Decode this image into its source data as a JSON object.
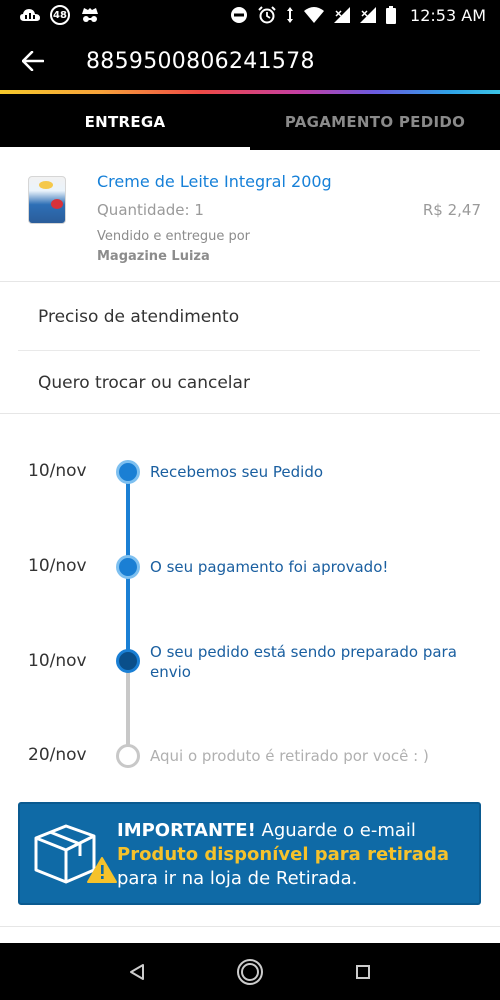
{
  "status_bar": {
    "notification_badge": "48",
    "time": "12:53 AM",
    "icons": [
      "cloud-icon",
      "notification-count-icon",
      "incognito-icon",
      "do-not-disturb-icon",
      "alarm-icon",
      "data-transfer-icon",
      "wifi-icon",
      "signal-icon",
      "signal-icon",
      "battery-icon"
    ]
  },
  "app_bar": {
    "back_icon": "arrow-left-icon",
    "title": "8859500806241578"
  },
  "tabs": [
    {
      "label": "ENTREGA",
      "active": true
    },
    {
      "label": "PAGAMENTO PEDIDO",
      "active": false
    }
  ],
  "product": {
    "name": "Creme de Leite Integral 200g",
    "quantity": "Quantidade: 1",
    "price": "R$ 2,47",
    "seller_prefix": "Vendido e entregue por",
    "seller_name": "Magazine Luiza"
  },
  "menu": {
    "items": [
      "Preciso de atendimento",
      "Quero trocar ou cancelar"
    ]
  },
  "timeline": {
    "steps": [
      {
        "date": "10/nov",
        "text": "Recebemos seu Pedido",
        "status": "done"
      },
      {
        "date": "10/nov",
        "text": "O seu pagamento foi aprovado!",
        "status": "done"
      },
      {
        "date": "10/nov",
        "text": "O seu pedido está sendo preparado para envio",
        "status": "current"
      },
      {
        "date": "20/nov",
        "text": "Aqui o produto é retirado por você : )",
        "status": "pending"
      }
    ]
  },
  "notice": {
    "strong": "IMPORTANTE!",
    "line1_rest": " Aguarde o e-mail",
    "highlight": "Produto disponível para retirada",
    "line3": "para ir na loja de Retirada.",
    "icon": "box-warning-icon"
  },
  "nav_bar": {
    "icons": [
      "back-triangle-icon",
      "home-circle-icon",
      "recents-square-icon"
    ]
  },
  "colors": {
    "accent_blue": "#1a7fd4",
    "notice_blue": "#0f6aa6",
    "warning_yellow": "#f6c22b",
    "black": "#000000"
  }
}
